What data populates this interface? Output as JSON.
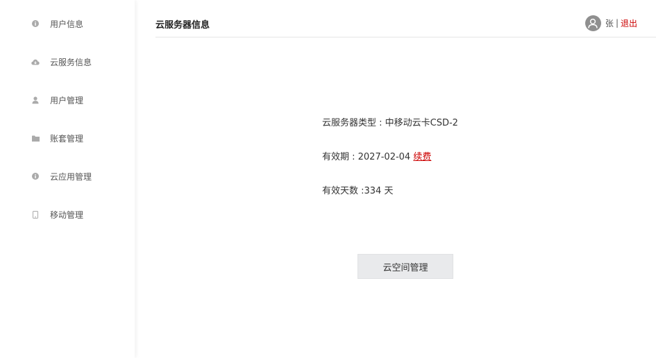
{
  "sidebar": {
    "items": [
      {
        "label": "用户信息",
        "icon": "info-icon"
      },
      {
        "label": "云服务信息",
        "icon": "cloud-icon"
      },
      {
        "label": "用户管理",
        "icon": "user-icon"
      },
      {
        "label": "账套管理",
        "icon": "folder-icon"
      },
      {
        "label": "云应用管理",
        "icon": "info-icon"
      },
      {
        "label": "移动管理",
        "icon": "mobile-icon"
      }
    ]
  },
  "header": {
    "title": "云服务器信息",
    "user_name": "张",
    "separator": "|",
    "logout_label": "退出"
  },
  "main": {
    "server_type": "云服务器类型 : 中移动云卡CSD-2",
    "validity_label": "有效期 : 2027-02-04",
    "renew_label": "续费",
    "days_left": "有效天数 :334 天",
    "cloud_space_button": "云空间管理"
  },
  "colors": {
    "accent_red": "#cc0000",
    "icon_gray": "#aaaaaa",
    "avatar_gray": "#8f8f8f",
    "button_bg": "#e9eaec"
  }
}
